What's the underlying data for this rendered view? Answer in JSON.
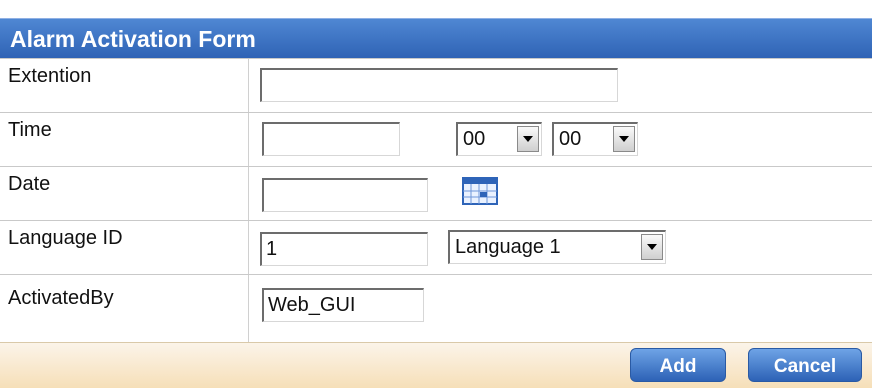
{
  "title": "Alarm Activation Form",
  "fields": {
    "extension": {
      "label": "Extention",
      "value": ""
    },
    "time": {
      "label": "Time",
      "value": "",
      "hour": "00",
      "minute": "00"
    },
    "date": {
      "label": "Date",
      "value": ""
    },
    "language_id": {
      "label": "Language ID",
      "value": "1",
      "language_select": "Language 1"
    },
    "activated_by": {
      "label": "ActivatedBy",
      "value": "Web_GUI"
    }
  },
  "buttons": {
    "add": "Add",
    "cancel": "Cancel"
  },
  "icons": {
    "calendar": "calendar-icon"
  },
  "colors": {
    "header": "#3a6fc3",
    "button": "#3b72c8",
    "footer": "#f6dfb8"
  }
}
